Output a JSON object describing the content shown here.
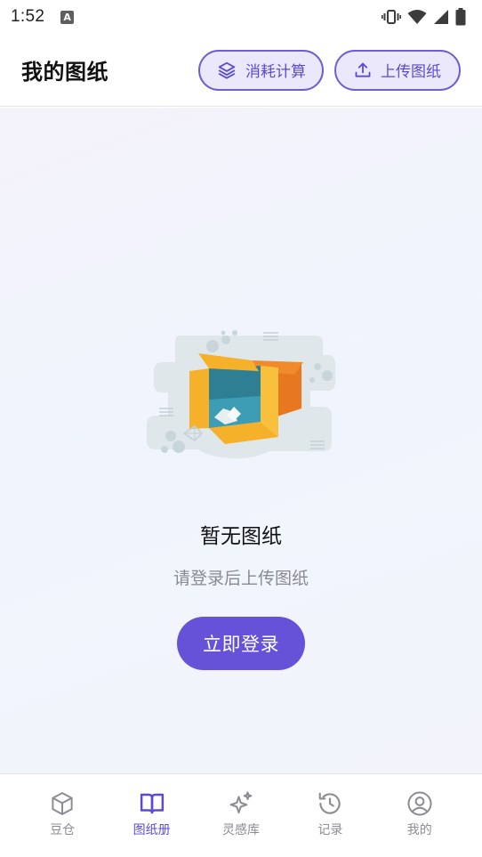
{
  "status_bar": {
    "time": "1:52",
    "notification_icon_letter": "A",
    "icons": [
      "vibrate-icon",
      "wifi-icon",
      "signal-icon",
      "battery-icon"
    ]
  },
  "header": {
    "title": "我的图纸",
    "consume_button": "消耗计算",
    "upload_button": "上传图纸"
  },
  "empty_state": {
    "title": "暂无图纸",
    "subtitle": "请登录后上传图纸",
    "login_button": "立即登录"
  },
  "bottom_nav": {
    "active_index": 1,
    "items": [
      {
        "label": "豆仓",
        "icon": "cube-icon"
      },
      {
        "label": "图纸册",
        "icon": "book-icon"
      },
      {
        "label": "灵感库",
        "icon": "sparkle-icon"
      },
      {
        "label": "记录",
        "icon": "history-icon"
      },
      {
        "label": "我的",
        "icon": "user-circle-icon"
      }
    ]
  },
  "colors": {
    "accent": "#6652d9",
    "accent_light": "#ece8fb",
    "inactive": "#8c8c92"
  }
}
